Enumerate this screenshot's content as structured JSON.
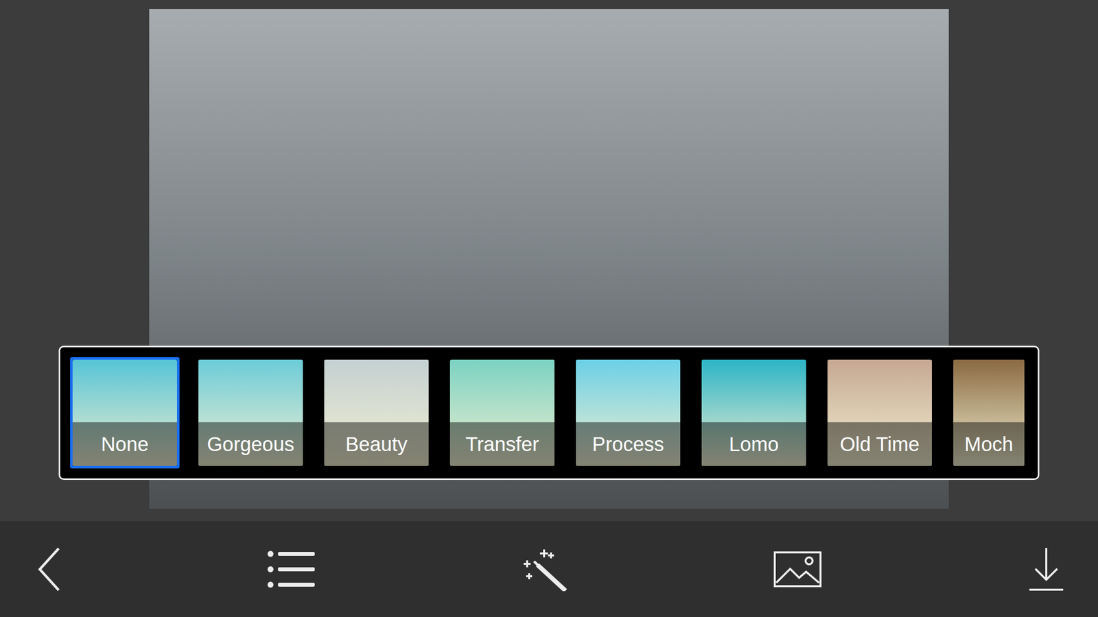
{
  "filters": [
    {
      "label": "None",
      "selected": true,
      "color": "#56c4d6"
    },
    {
      "label": "Gorgeous",
      "selected": false,
      "color": "#6cccd8"
    },
    {
      "label": "Beauty",
      "selected": false,
      "color": "#c4d0d2"
    },
    {
      "label": "Transfer",
      "selected": false,
      "color": "#7cd2c2"
    },
    {
      "label": "Process",
      "selected": false,
      "color": "#6cd0e6"
    },
    {
      "label": "Lomo",
      "selected": false,
      "color": "#2cb4c6"
    },
    {
      "label": "Old Time",
      "selected": false,
      "color": "#c6a892"
    },
    {
      "label": "Moch",
      "selected": false,
      "color": "#8a6a42"
    }
  ]
}
